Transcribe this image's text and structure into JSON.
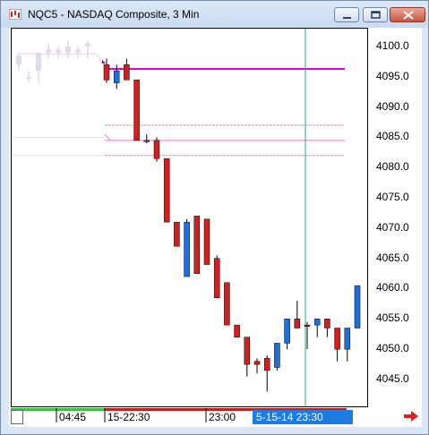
{
  "window": {
    "title": "NQC5 - NASDAQ Composite, 3 Min",
    "buttons": [
      "minimize",
      "maximize",
      "close"
    ]
  },
  "colors": {
    "up": "#1e6fd9",
    "down": "#d02020",
    "vline": "#2aa0a0",
    "level": "#e000e0",
    "pink": "#f07ac0"
  },
  "y_axis": {
    "labels": [
      "4100.0",
      "4095.0",
      "4090.0",
      "4085.0",
      "4080.0",
      "4075.0",
      "4070.0",
      "4065.0",
      "4060.0",
      "4055.0",
      "4050.0",
      "4045.0"
    ]
  },
  "x_axis": {
    "labels": [
      "04:45",
      "15-22:30",
      "23:00"
    ],
    "cursor_time": "5-15-14  23:30"
  },
  "chart_data": {
    "type": "candlestick",
    "y_range": [
      4042,
      4103
    ],
    "lines": [
      4096.3
    ],
    "candles": [
      {
        "o": 4097,
        "h": 4098,
        "l": 4094,
        "c": 4094.5
      },
      {
        "o": 4094,
        "h": 4097,
        "l": 4093,
        "c": 4096
      },
      {
        "o": 4097,
        "h": 4098,
        "l": 4094.5,
        "c": 4094.5
      },
      {
        "o": 4094.5,
        "h": 4094.5,
        "l": 4084.5,
        "c": 4084.5
      },
      {
        "o": 4084.5,
        "h": 4085.5,
        "l": 4084,
        "c": 4084.5
      },
      {
        "o": 4084.5,
        "h": 4085,
        "l": 4081,
        "c": 4081.5
      },
      {
        "o": 4081.5,
        "h": 4081.5,
        "l": 4071,
        "c": 4071
      },
      {
        "o": 4071,
        "h": 4071,
        "l": 4067,
        "c": 4067
      },
      {
        "o": 4062,
        "h": 4071.5,
        "l": 4062,
        "c": 4071
      },
      {
        "o": 4072,
        "h": 4072,
        "l": 4062.5,
        "c": 4062.5
      },
      {
        "o": 4071.5,
        "h": 4071.5,
        "l": 4064,
        "c": 4064
      },
      {
        "o": 4065,
        "h": 4065.5,
        "l": 4058.5,
        "c": 4058.5
      },
      {
        "o": 4061,
        "h": 4061,
        "l": 4054,
        "c": 4054
      },
      {
        "o": 4054,
        "h": 4054,
        "l": 4052,
        "c": 4052
      },
      {
        "o": 4052,
        "h": 4052,
        "l": 4045.5,
        "c": 4047.5
      },
      {
        "o": 4048,
        "h": 4048.5,
        "l": 4046,
        "c": 4047.5
      },
      {
        "o": 4048.5,
        "h": 4049,
        "l": 4043,
        "c": 4046.5
      },
      {
        "o": 4047,
        "h": 4051,
        "l": 4046.5,
        "c": 4051
      },
      {
        "o": 4051,
        "h": 4055,
        "l": 4050,
        "c": 4055
      },
      {
        "o": 4055,
        "h": 4058,
        "l": 4053.5,
        "c": 4053.5
      },
      {
        "o": 4054,
        "h": 4054.5,
        "l": 4050,
        "c": 4054
      },
      {
        "o": 4054,
        "h": 4055,
        "l": 4052,
        "c": 4055
      },
      {
        "o": 4055,
        "h": 4055,
        "l": 4052,
        "c": 4053.5
      },
      {
        "o": 4053.5,
        "h": 4053.5,
        "l": 4048,
        "c": 4050
      },
      {
        "o": 4050,
        "h": 4053.5,
        "l": 4048,
        "c": 4053.5
      },
      {
        "o": 4053.5,
        "h": 4060.5,
        "l": 4053.5,
        "c": 4060.5
      }
    ]
  }
}
